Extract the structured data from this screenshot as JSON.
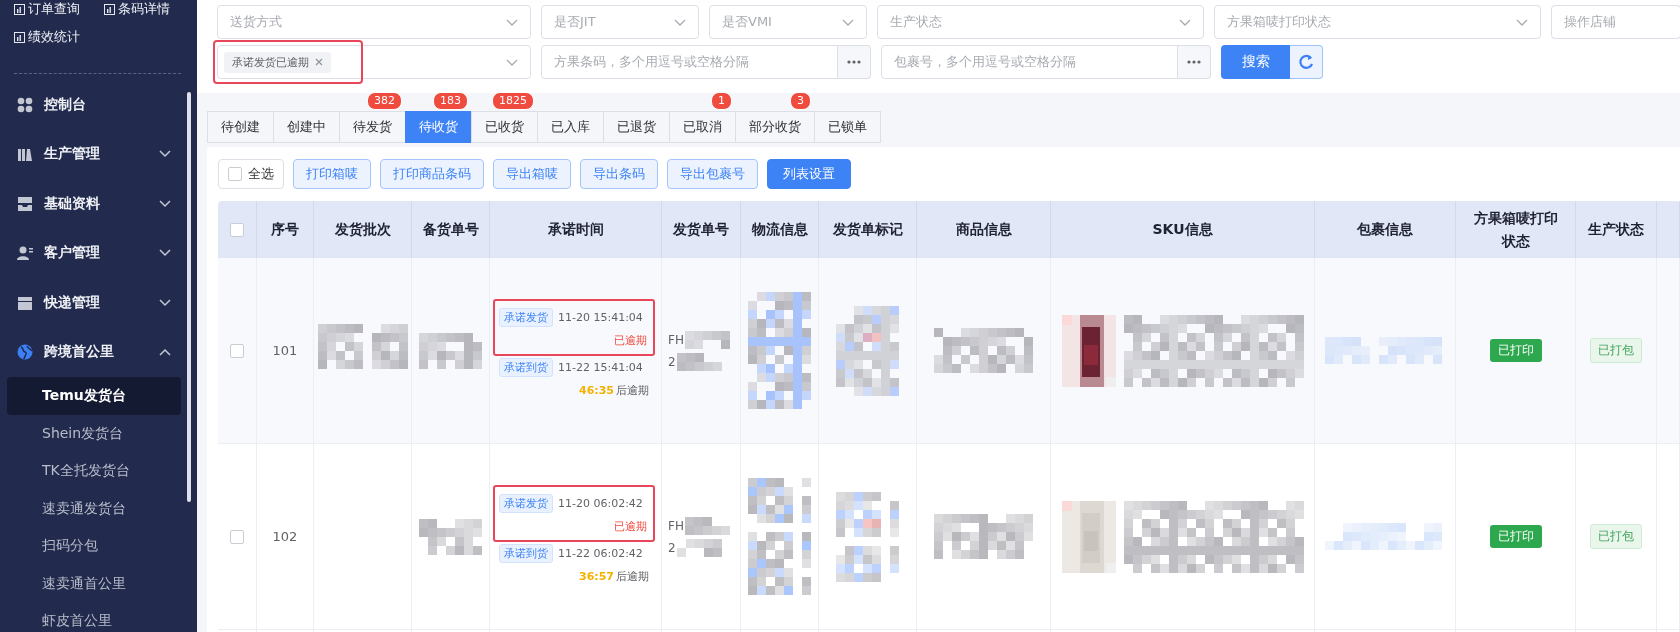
{
  "sidebar": {
    "top_links": [
      {
        "label": "订单查询"
      },
      {
        "label": "条码详情"
      },
      {
        "label": "绩效统计"
      }
    ],
    "menu": [
      {
        "label": "控制台",
        "kind": "link"
      },
      {
        "label": "生产管理",
        "kind": "group",
        "expanded": false
      },
      {
        "label": "基础资料",
        "kind": "group",
        "expanded": false
      },
      {
        "label": "客户管理",
        "kind": "group",
        "expanded": false
      },
      {
        "label": "快递管理",
        "kind": "group",
        "expanded": false
      },
      {
        "label": "跨境首公里",
        "kind": "group",
        "expanded": true,
        "children": [
          {
            "label": "Temu发货台",
            "selected": true
          },
          {
            "label": "Shein发货台",
            "selected": false
          },
          {
            "label": "TK全托发货台",
            "selected": false
          },
          {
            "label": "速卖通发货台",
            "selected": false
          },
          {
            "label": "扫码分包",
            "selected": false
          },
          {
            "label": "速卖通首公里",
            "selected": false
          },
          {
            "label": "虾皮首公里",
            "selected": false
          }
        ]
      }
    ]
  },
  "filters": {
    "row1": [
      {
        "kind": "select",
        "placeholder": "送货方式"
      },
      {
        "kind": "select",
        "placeholder": "是否JIT"
      },
      {
        "kind": "select",
        "placeholder": "是否VMI"
      },
      {
        "kind": "select",
        "placeholder": "生产状态"
      },
      {
        "kind": "select",
        "placeholder": "方果箱唛打印状态"
      },
      {
        "kind": "input",
        "placeholder": "操作店铺"
      }
    ],
    "row2": [
      {
        "kind": "tag-select",
        "tags": [
          "承诺发货已逾期"
        ],
        "highlighted": true
      },
      {
        "kind": "multi-input",
        "placeholder": "方果条码，多个用逗号或空格分隔"
      },
      {
        "kind": "multi-input",
        "placeholder": "包裹号，多个用逗号或空格分隔"
      }
    ],
    "search_button": "搜索"
  },
  "tabs": [
    {
      "label": "待创建",
      "selected": false
    },
    {
      "label": "创建中",
      "selected": false
    },
    {
      "label": "待发货",
      "selected": false,
      "badge": "382"
    },
    {
      "label": "待收货",
      "selected": true,
      "badge": "183"
    },
    {
      "label": "已收货",
      "selected": false,
      "badge": "1825"
    },
    {
      "label": "已入库",
      "selected": false
    },
    {
      "label": "已退货",
      "selected": false
    },
    {
      "label": "已取消",
      "selected": false,
      "badge": "1"
    },
    {
      "label": "部分收货",
      "selected": false,
      "badge": "3"
    },
    {
      "label": "已锁单",
      "selected": false
    }
  ],
  "toolbar": {
    "select_all": {
      "label": "全选",
      "checked": false
    },
    "buttons": [
      {
        "label": "打印箱唛",
        "kind": "plain"
      },
      {
        "label": "打印商品条码",
        "kind": "plain"
      },
      {
        "label": "导出箱唛",
        "kind": "plain"
      },
      {
        "label": "导出条码",
        "kind": "plain"
      },
      {
        "label": "导出包裹号",
        "kind": "plain"
      },
      {
        "label": "列表设置",
        "kind": "primary"
      }
    ]
  },
  "table": {
    "header_checked": false,
    "columns": [
      "序号",
      "发货批次",
      "备货单号",
      "承诺时间",
      "发货单号",
      "物流信息",
      "发货单标记",
      "商品信息",
      "SKU信息",
      "包裹信息",
      "方果箱唛打印状态",
      "生产状态"
    ],
    "rows": [
      {
        "checked": false,
        "index": "101",
        "promise_ship": {
          "tag": "承诺发货",
          "time": "11-20 15:41:04",
          "status": "已逾期",
          "highlighted": true
        },
        "promise_arrive": {
          "tag": "承诺到货",
          "time": "11-22 15:41:04",
          "countdown": "46:35",
          "suffix": "后逾期"
        },
        "ship_no": [
          "FH",
          "2"
        ],
        "print_status": "已打印",
        "production_status": "已打包"
      },
      {
        "checked": false,
        "index": "102",
        "promise_ship": {
          "tag": "承诺发货",
          "time": "11-20 06:02:42",
          "status": "已逾期",
          "highlighted": true
        },
        "promise_arrive": {
          "tag": "承诺到货",
          "time": "11-22 06:02:42",
          "countdown": "36:57",
          "suffix": "后逾期"
        },
        "ship_no": [
          "FH",
          "2"
        ],
        "print_status": "已打印",
        "production_status": "已打包"
      }
    ]
  }
}
